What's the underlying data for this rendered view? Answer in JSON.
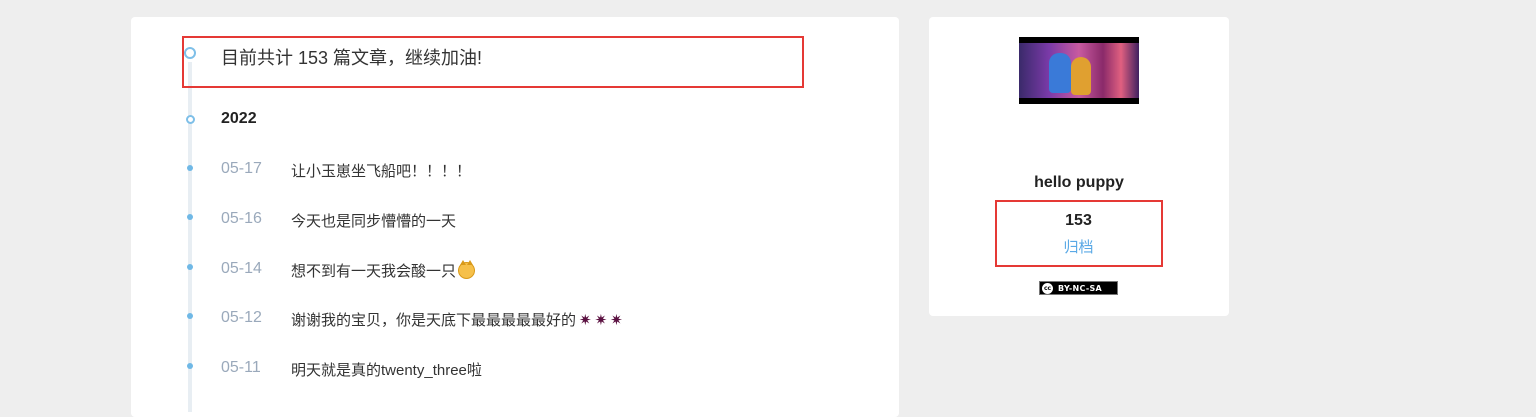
{
  "archive": {
    "summary": "目前共计 153 篇文章，继续加油!",
    "year": "2022",
    "posts": [
      {
        "date": "05-17",
        "title": "让小玉崽坐飞船吧！！！！"
      },
      {
        "date": "05-16",
        "title": "今天也是同步懵懵的一天"
      },
      {
        "date": "05-14",
        "title": "想不到有一天我会酸一只",
        "emoji": "cat-face-icon"
      },
      {
        "date": "05-12",
        "title": "谢谢我的宝贝，你是天底下最最最最最好的",
        "emoji": "sparkle-icon"
      },
      {
        "date": "05-11",
        "title": "明天就是真的twenty_three啦"
      }
    ]
  },
  "sidebar": {
    "username": "hello puppy",
    "post_count": "153",
    "archive_label": "归档",
    "license": "BY-NC-SA",
    "license_icon": "cc"
  },
  "colors": {
    "accent": "#5aa9e6",
    "highlight": "#e53935",
    "background": "#eeeeee"
  }
}
